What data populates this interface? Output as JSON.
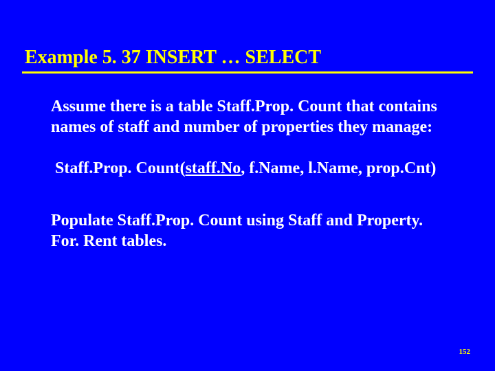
{
  "slide": {
    "title": "Example 5. 37  INSERT … SELECT",
    "para1": "Assume there is a table Staff.Prop. Count that contains names of staff and number of properties they manage:",
    "schema_prefix": "Staff.Prop. Count(",
    "schema_key": "staff.No",
    "schema_rest": ", f.Name, l.Name, prop.Cnt)",
    "para2": "Populate Staff.Prop. Count using Staff and Property. For. Rent tables.",
    "page_number": "152"
  }
}
